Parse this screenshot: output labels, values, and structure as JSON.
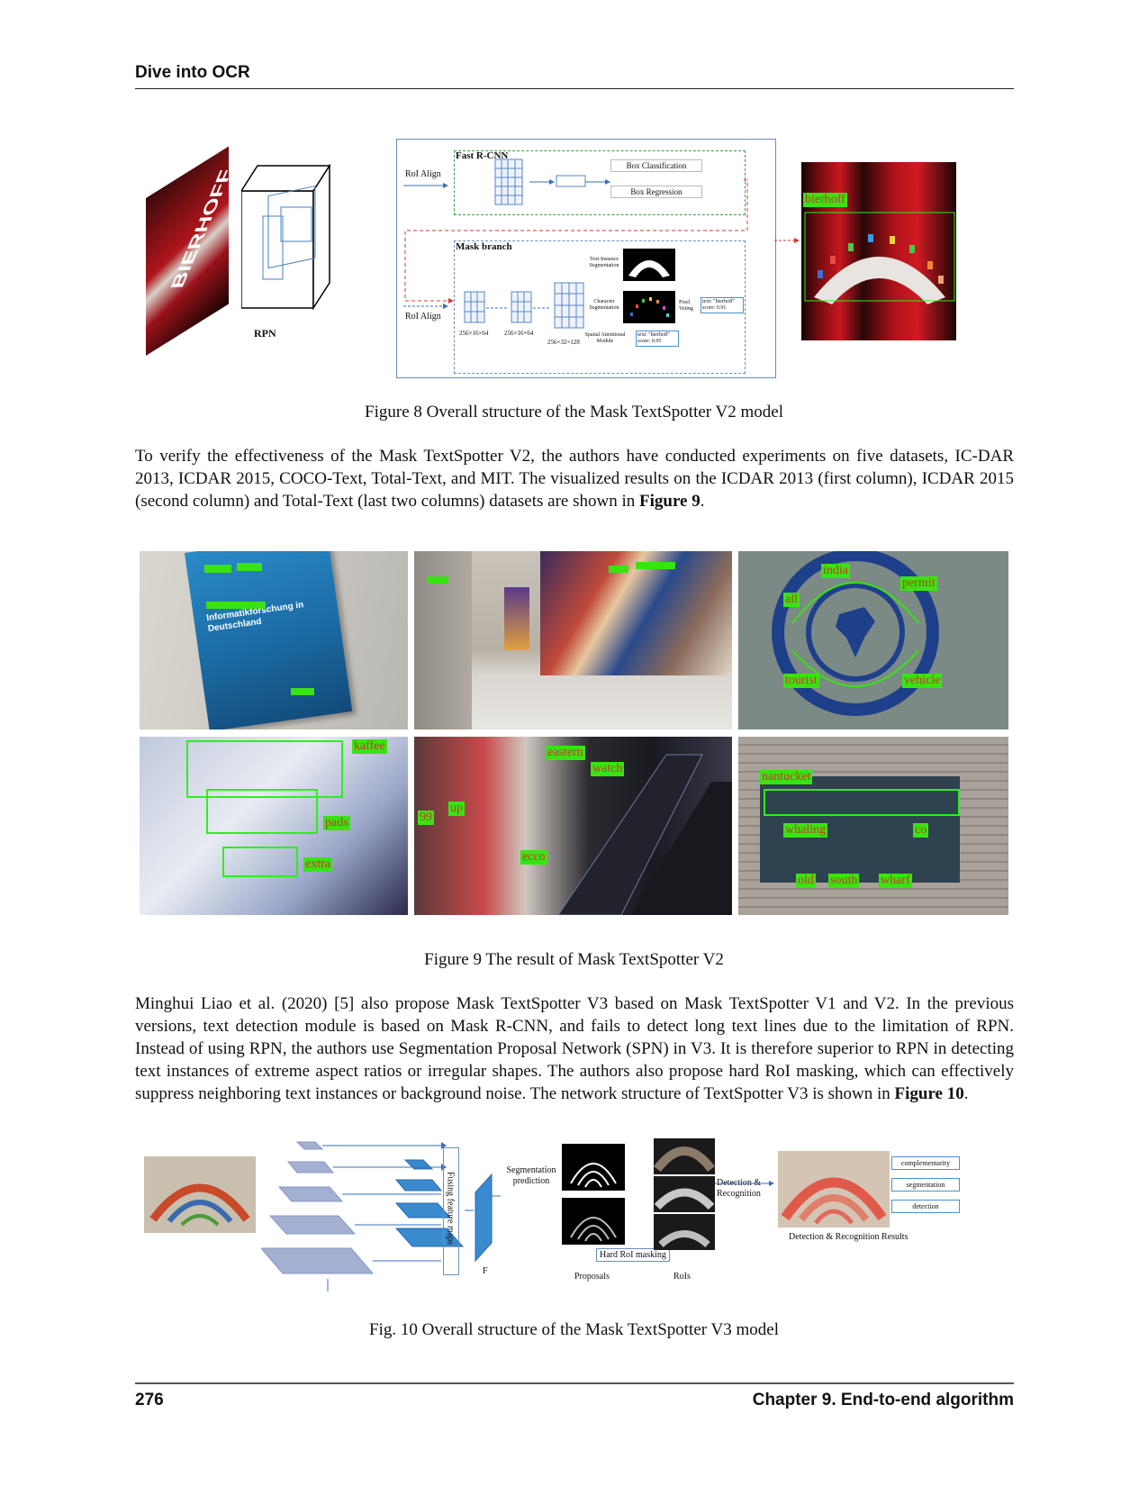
{
  "header": {
    "title": "Dive into OCR"
  },
  "figure8": {
    "caption": "Figure 8 Overall structure of the Mask TextSpotter V2 model",
    "rpn_label": "RPN",
    "roi_align_1": "RoI Align",
    "roi_align_2": "RoI Align",
    "fast_rcnn": "Fast R-CNN",
    "box_classification": "Box Classification",
    "box_regression": "Box Regression",
    "mask_branch": "Mask branch",
    "text_instance_seg": "Text Instance Segmentation",
    "char_seg": "Character Segmentation",
    "pixel_voting": "Pixel Voting",
    "spatial_attention": "Spatial Attentional Module",
    "result1": "text: \"bierhoff\" score: 0.91",
    "result2": "text: \"bierhoff\" score: 0.95",
    "dim1": "256×16×64",
    "dim2": "256×16×64",
    "dim3": "256×32×128",
    "output_tag": "bierhoff",
    "left_image_text": "BIERHOFF"
  },
  "para1": {
    "text": "To verify the effectiveness of the Mask TextSpotter V2, the authors have conducted experiments on five datasets, IC-DAR 2013, ICDAR 2015, COCO-Text, Total-Text, and MIT. The visualized results on the ICDAR 2013 (first column), ICDAR 2015 (second column) and Total-Text (last two columns) datasets are shown in ",
    "ref": "Figure 9",
    "end": "."
  },
  "figure9": {
    "caption": "Figure 9 The result of Mask TextSpotter V2",
    "book_title": "Informatikforschung in Deutschland",
    "panel3_tags": [
      "india",
      "permit",
      "all",
      "tourist",
      "vehicle"
    ],
    "panel4_tags": [
      "kaffee",
      "pads",
      "extra"
    ],
    "panel5_tags": [
      "eastern",
      "watch",
      "up",
      "99",
      "ecco"
    ],
    "panel6_tags": [
      "nantucket",
      "whaling",
      "co",
      "old",
      "south",
      "wharf"
    ]
  },
  "para2": {
    "text": "Minghui Liao et al. (2020) [5] also propose Mask TextSpotter V3 based on Mask TextSpotter V1 and V2. In the previous versions, text detection module is based on Mask R-CNN, and fails to detect long text lines due to the limitation of RPN. Instead of using RPN, the authors use Segmentation Proposal Network (SPN) in V3. It is therefore superior to RPN in detecting text instances of extreme aspect ratios or irregular shapes. The authors also propose hard RoI masking, which can effectively suppress neighboring text instances or background noise. The network structure of TextSpotter V3 is shown in ",
    "ref": "Figure 10",
    "end": "."
  },
  "figure10": {
    "caption": "Fig. 10 Overall structure of the Mask TextSpotter V3 model",
    "fusing": "Fusing feature maps",
    "f_label": "F",
    "seg_prediction": "Segmentation prediction",
    "hard_roi": "Hard RoI masking",
    "proposals": "Proposals",
    "rois": "RoIs",
    "det_rec": "Detection & Recognition",
    "results_label": "Detection & Recognition Results",
    "words": [
      "complementarity",
      "segmentation",
      "detection"
    ]
  },
  "footer": {
    "page_number": "276",
    "chapter": "Chapter 9.  End-to-end algorithm"
  }
}
